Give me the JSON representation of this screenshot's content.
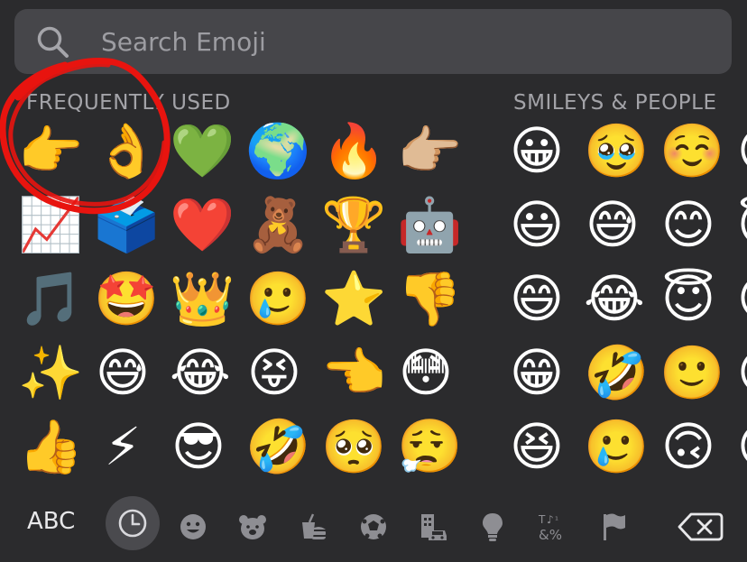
{
  "search": {
    "placeholder": "Search Emoji"
  },
  "sections": {
    "frequently_used": "FREQUENTLY USED",
    "smileys_people": "SMILEYS & PEOPLE"
  },
  "frequently_used_emojis": [
    "👉",
    "👌",
    "💚",
    "🌍",
    "🔥",
    "👉🏼",
    "📈",
    "🗳️",
    "❤️",
    "🧸",
    "🏆",
    "🤖",
    "🎵",
    "🤩",
    "👑",
    "🥲",
    "⭐",
    "👎",
    "✨",
    "😅",
    "😂",
    "😝",
    "👈",
    "😳",
    "👍",
    "⚡",
    "😎",
    "🤣",
    "🥺",
    "😮‍💨"
  ],
  "smileys_emojis": [
    "😀",
    "🥹",
    "☺️",
    "😀",
    "😃",
    "😅",
    "😊",
    "😇",
    "😄",
    "😂",
    "😇",
    "😘",
    "😁",
    "🤣",
    "🙂",
    "😍",
    "😆",
    "🥲",
    "🙃",
    "😗"
  ],
  "keyboard": {
    "abc_label": "ABC"
  },
  "categories": [
    "recent-icon",
    "smiley-icon",
    "animal-icon",
    "food-icon",
    "activity-icon",
    "travel-icon",
    "objects-icon",
    "symbols-icon",
    "flag-icon",
    "backspace-icon"
  ],
  "colors": {
    "background": "#2b2b2d",
    "search_bg": "#46464a",
    "annotation": "#e8140f"
  }
}
